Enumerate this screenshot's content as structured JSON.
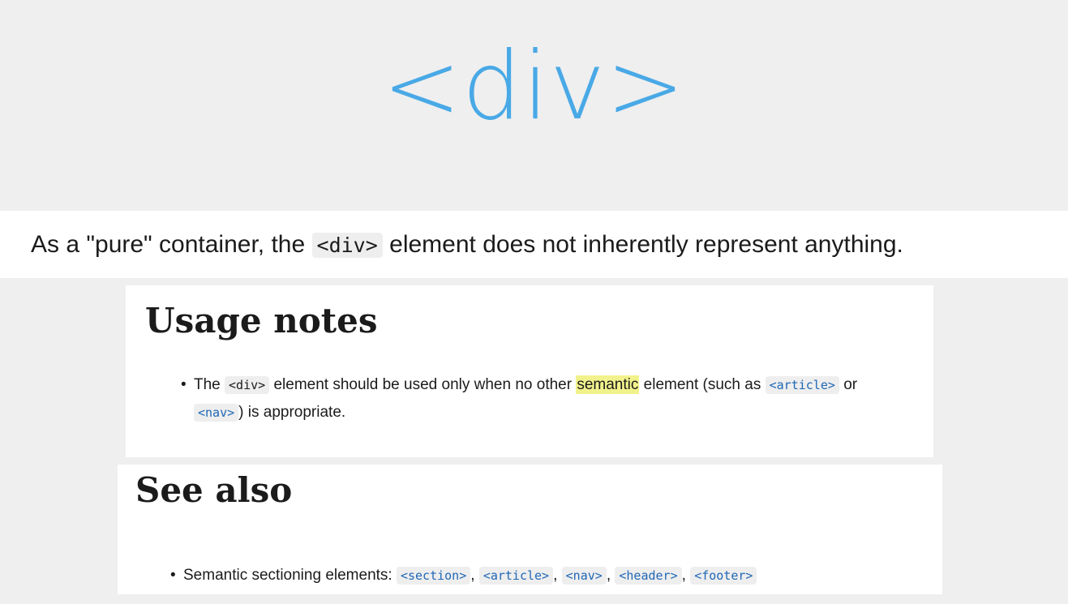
{
  "title": "<div>",
  "intro": {
    "before": "As a \"pure\" container, the",
    "code": "<div>",
    "after": "element does not inherently represent anything."
  },
  "usage_notes": {
    "heading": "Usage notes",
    "item": {
      "text1": "The",
      "code_div": "<div>",
      "text2": "element should be used only when no other",
      "highlight": "semantic",
      "text3": "element (such as",
      "code_article": "<article>",
      "text4": "or",
      "code_nav": "<nav>",
      "text5": ") is appropriate."
    }
  },
  "see_also": {
    "heading": "See also",
    "item": {
      "label": "Semantic sectioning elements:",
      "links": [
        "<section>",
        "<article>",
        "<nav>",
        "<header>",
        "<footer>"
      ],
      "separator": ","
    }
  },
  "colors": {
    "background": "#efefef",
    "title": "#49a9e6",
    "panel": "#ffffff",
    "code_background": "#eeeeee",
    "link": "#1f67b6",
    "highlight": "#f2f28c"
  }
}
